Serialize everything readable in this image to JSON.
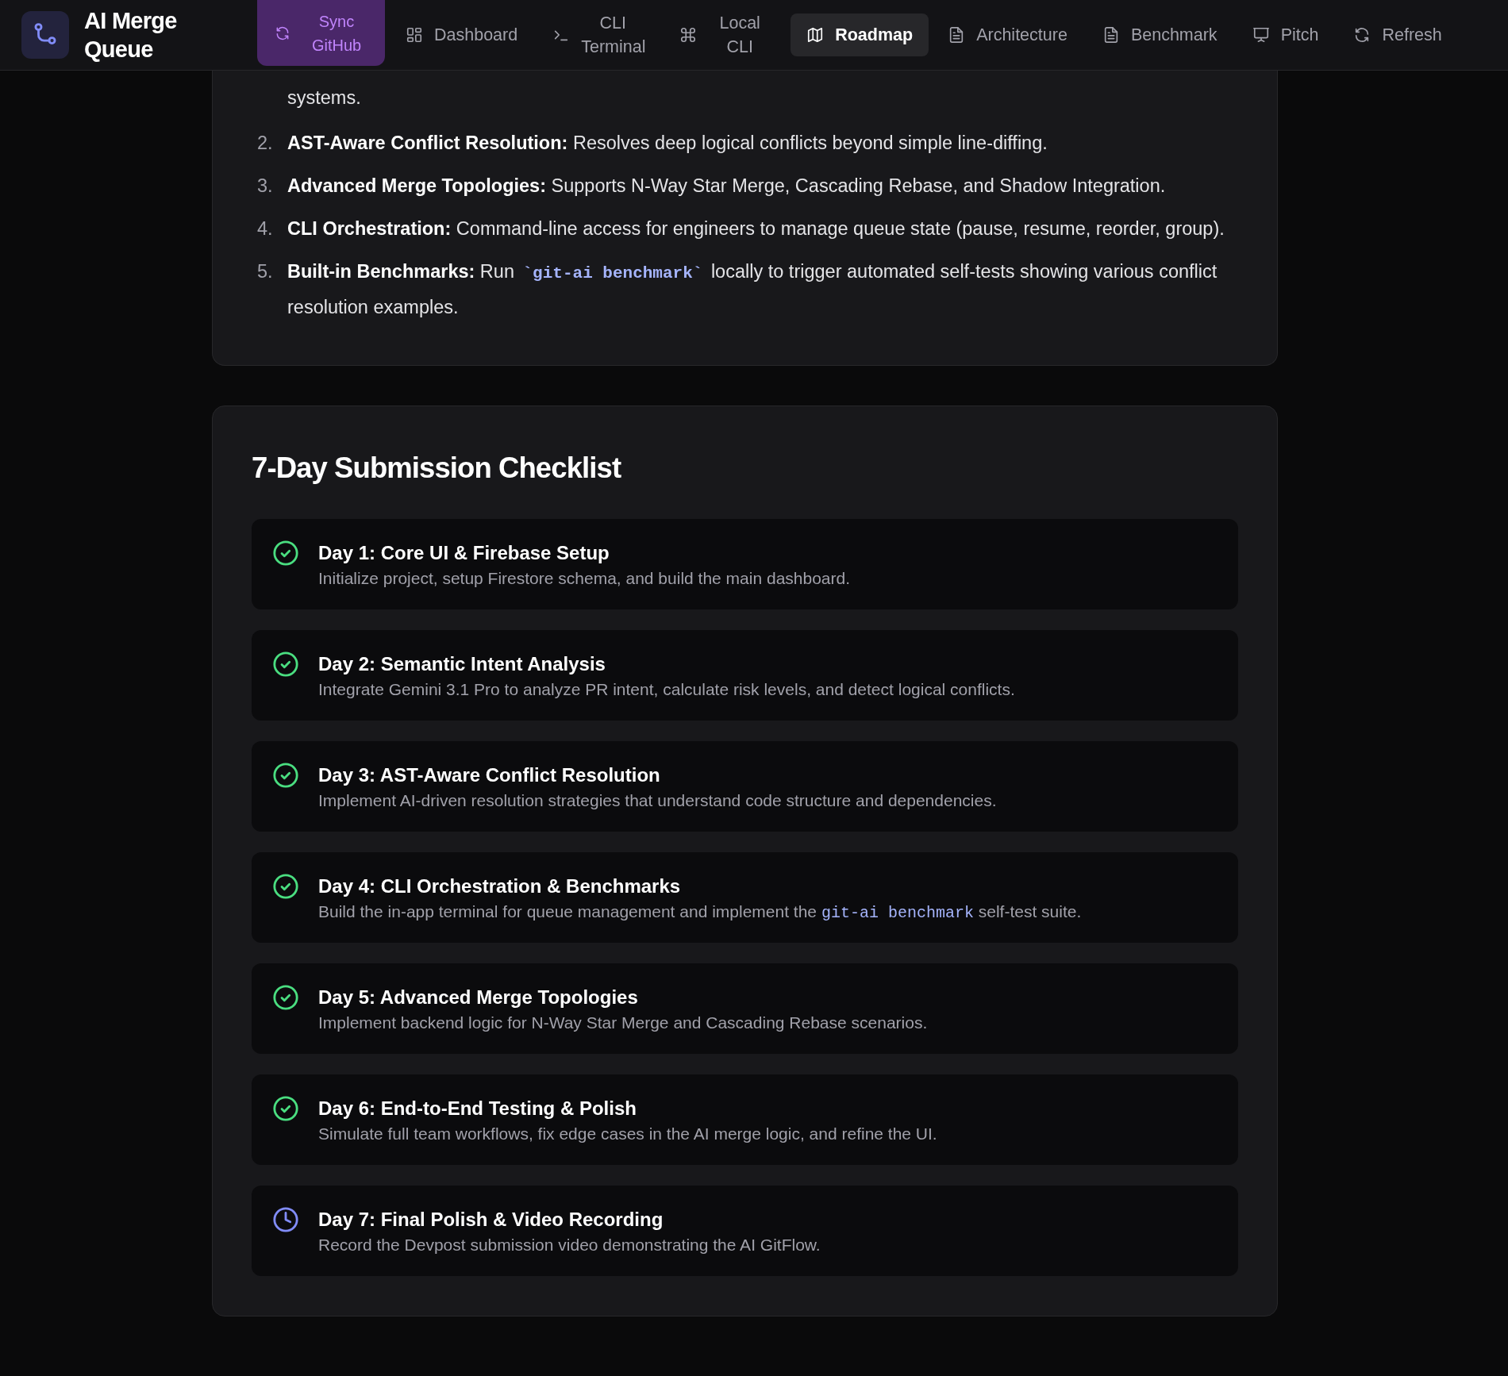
{
  "header": {
    "app_title": "AI Merge Queue",
    "sync_button": {
      "label": "Sync GitHub"
    },
    "nav": [
      {
        "label": "Dashboard",
        "kind": "grid",
        "selected": false
      },
      {
        "label": "CLI Terminal",
        "kind": "prompt",
        "selected": false
      },
      {
        "label": "Local CLI",
        "kind": "command",
        "selected": false
      },
      {
        "label": "Roadmap",
        "kind": "map",
        "selected": true
      },
      {
        "label": "Architecture",
        "kind": "doc",
        "selected": false
      },
      {
        "label": "Benchmark",
        "kind": "doc",
        "selected": false
      },
      {
        "label": "Pitch",
        "kind": "presentation",
        "selected": false
      }
    ],
    "refresh_button": {
      "label": "Refresh"
    }
  },
  "features": {
    "partial_first_item": "systems.",
    "items": [
      {
        "number": "2.",
        "lead": "AST-Aware Conflict Resolution:",
        "parts": [
          {
            "kind": "text",
            "text": " Resolves deep logical conflicts beyond simple line-diffing."
          }
        ]
      },
      {
        "number": "3.",
        "lead": "Advanced Merge Topologies:",
        "parts": [
          {
            "kind": "text",
            "text": " Supports N-Way Star Merge, Cascading Rebase, and Shadow Integration."
          }
        ]
      },
      {
        "number": "4.",
        "lead": "CLI Orchestration:",
        "parts": [
          {
            "kind": "text",
            "text": " Command-line access for engineers to manage queue state (pause, resume, reorder, group)."
          }
        ]
      },
      {
        "number": "5.",
        "lead": "Built-in Benchmarks:",
        "parts": [
          {
            "kind": "text",
            "text": " Run "
          },
          {
            "kind": "code",
            "text": "`git-ai benchmark`"
          },
          {
            "kind": "text",
            "text": " locally to trigger automated self-tests showing various conflict resolution examples."
          }
        ]
      }
    ]
  },
  "checklist": {
    "title": "7-Day Submission Checklist",
    "items": [
      {
        "title": "Day 1: Core UI & Firebase Setup",
        "done": true,
        "parts": [
          {
            "kind": "text",
            "text": "Initialize project, setup Firestore schema, and build the main dashboard."
          }
        ]
      },
      {
        "title": "Day 2: Semantic Intent Analysis",
        "done": true,
        "parts": [
          {
            "kind": "text",
            "text": "Integrate Gemini 3.1 Pro to analyze PR intent, calculate risk levels, and detect logical conflicts."
          }
        ]
      },
      {
        "title": "Day 3: AST-Aware Conflict Resolution",
        "done": true,
        "parts": [
          {
            "kind": "text",
            "text": "Implement AI-driven resolution strategies that understand code structure and dependencies."
          }
        ]
      },
      {
        "title": "Day 4: CLI Orchestration & Benchmarks",
        "done": true,
        "parts": [
          {
            "kind": "text",
            "text": "Build the in-app terminal for queue management and implement the "
          },
          {
            "kind": "code",
            "text": "git-ai benchmark"
          },
          {
            "kind": "text",
            "text": " self-test suite."
          }
        ]
      },
      {
        "title": "Day 5: Advanced Merge Topologies",
        "done": true,
        "parts": [
          {
            "kind": "text",
            "text": "Implement backend logic for N-Way Star Merge and Cascading Rebase scenarios."
          }
        ]
      },
      {
        "title": "Day 6: End-to-End Testing & Polish",
        "done": true,
        "parts": [
          {
            "kind": "text",
            "text": "Simulate full team workflows, fix edge cases in the AI merge logic, and refine the UI."
          }
        ]
      },
      {
        "title": "Day 7: Final Polish & Video Recording",
        "done": false,
        "parts": [
          {
            "kind": "text",
            "text": "Record the Devpost submission video demonstrating the AI GitFlow."
          }
        ]
      }
    ]
  }
}
